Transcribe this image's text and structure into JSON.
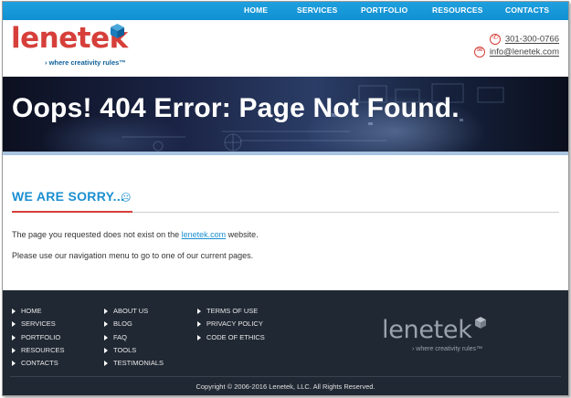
{
  "nav": {
    "items": [
      "HOME",
      "SERVICES",
      "PORTFOLIO",
      "RESOURCES",
      "CONTACTS"
    ]
  },
  "header": {
    "logo_text": "lenetek",
    "tagline": "› where creativity rules™",
    "phone": "301-300-0766",
    "email": "info@lenetek.com"
  },
  "hero": {
    "title": "Oops! 404 Error: Page Not Found."
  },
  "main": {
    "heading": "WE ARE SORRY...",
    "sad_icon": "☹",
    "para1_before": "The page you requested does not exist on the ",
    "para1_link": "lenetek.com",
    "para1_after": " website.",
    "para2": "Please use our navigation menu to go to one of our current pages."
  },
  "footer": {
    "col1": [
      "HOME",
      "SERVICES",
      "PORTFOLIO",
      "RESOURCES",
      "CONTACTS"
    ],
    "col2": [
      "ABOUT US",
      "BLOG",
      "FAQ",
      "TOOLS",
      "TESTIMONIALS"
    ],
    "col3": [
      "TERMS OF USE",
      "PRIVACY POLICY",
      "CODE OF ETHICS"
    ],
    "logo_text": "lenetek",
    "tagline": "› where creativity rules™",
    "copyright": "Copyright © 2006-2016 Lenetek, LLC. All Rights Reserved."
  },
  "colors": {
    "nav_blue": "#1190d2",
    "brand_red": "#d63f3a",
    "heading_blue": "#1a8fd0",
    "footer_bg": "#202833"
  },
  "icons": [
    "phone-icon",
    "email-icon",
    "cube-logo-icon",
    "sad-face-icon",
    "triangle-bullet-icon"
  ]
}
